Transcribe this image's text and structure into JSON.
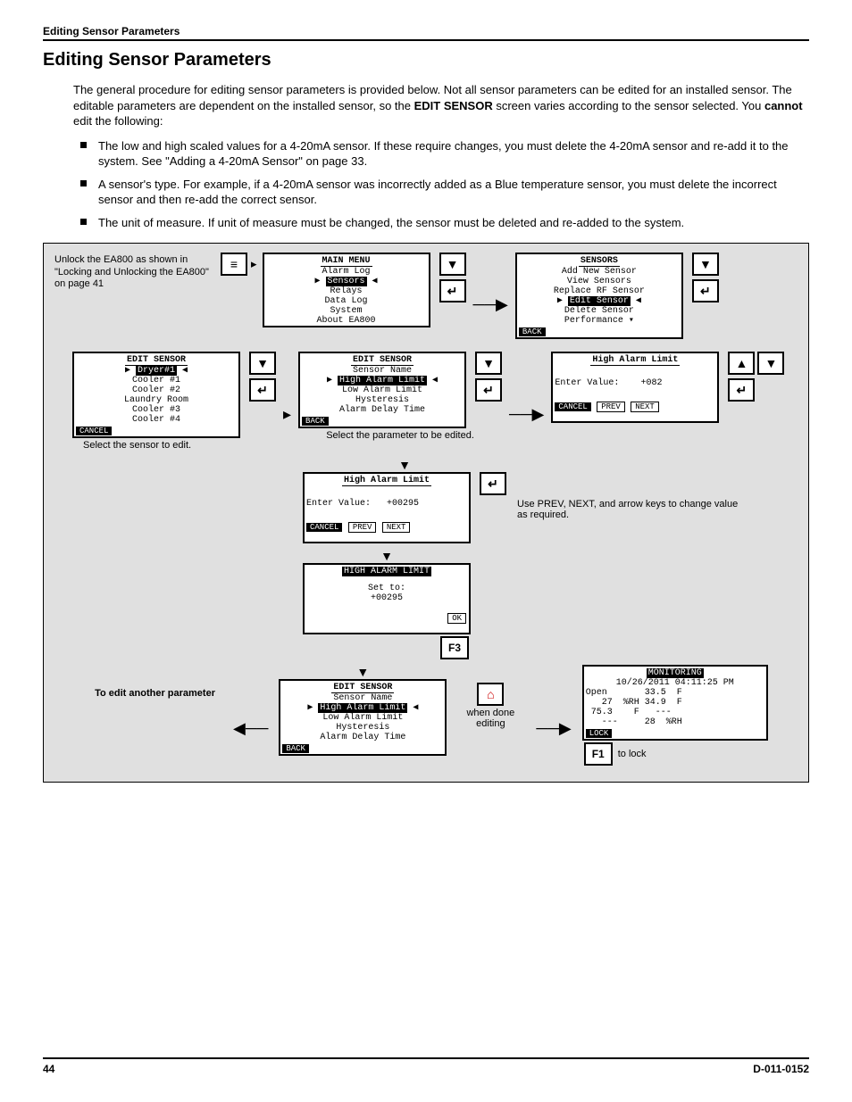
{
  "header": {
    "running_head": "Editing Sensor Parameters"
  },
  "title": "Editing Sensor Parameters",
  "intro": {
    "p1a": "The general procedure for editing sensor parameters is provided below. Not all sensor parameters can be edited for an installed sensor. The editable parameters are dependent on the installed sensor, so the ",
    "p1b_bold": "EDIT SENSOR",
    "p1c": " screen varies according to the sensor selected. You ",
    "p1d_bold": "cannot",
    "p1e": " edit the following:"
  },
  "bullets": [
    "The low and high scaled values for a 4-20mA sensor. If these require changes, you must delete the 4-20mA sensor and re-add it to the system. See \"Adding a 4-20mA Sensor\" on page 33.",
    "A sensor's type. For example, if a 4-20mA sensor was incorrectly added as a Blue temperature sensor, you must delete the incorrect sensor and then re-add the correct sensor.",
    "The unit of measure. If unit of measure must be changed, the sensor must be deleted and re-added to the system."
  ],
  "unlock_caption": "Unlock the EA800 as shown in \"Locking and Unlocking the EA800\" on page 41",
  "main_menu": {
    "title": "MAIN MENU",
    "items": [
      "Alarm Log",
      "Sensors",
      "Relays",
      "Data Log",
      "System",
      "About EA800"
    ],
    "highlight": "Sensors"
  },
  "sensors_menu": {
    "title": "SENSORS",
    "items": [
      "Add New Sensor",
      "View Sensors",
      "Replace RF Sensor",
      "Edit Sensor",
      "Delete Sensor",
      "Performance"
    ],
    "highlight": "Edit Sensor",
    "back": "BACK"
  },
  "edit_sensor_list": {
    "title": "EDIT SENSOR",
    "items": [
      "Dryer#1",
      "Cooler #1",
      "Cooler #2",
      "Laundry Room",
      "Cooler #3",
      "Cooler #4"
    ],
    "highlight": "Dryer#1",
    "cancel": "CANCEL",
    "caption": "Select the sensor to edit."
  },
  "edit_sensor_params": {
    "title": "EDIT SENSOR",
    "items": [
      "Sensor Name",
      "High Alarm Limit",
      "Low Alarm Limit",
      "Hysteresis",
      "Alarm Delay Time"
    ],
    "highlight": "High Alarm Limit",
    "back": "BACK",
    "caption": "Select the parameter to be edited."
  },
  "high_alarm_entry": {
    "title": "High Alarm Limit",
    "enter_label": "Enter Value:",
    "value": "+082",
    "cancel": "CANCEL",
    "prev": "PREV",
    "next": "NEXT"
  },
  "high_alarm_entry2": {
    "title": "High Alarm Limit",
    "enter_label": "Enter Value:",
    "value": "+00295",
    "cancel": "CANCEL",
    "prev": "PREV",
    "next": "NEXT",
    "caption": "Use PREV, NEXT, and arrow keys to change value as required."
  },
  "high_alarm_confirm": {
    "title": "HIGH ALARM LIMIT",
    "set_to": "Set to:",
    "value": "+00295",
    "ok": "OK",
    "softkey": "F3"
  },
  "edit_sensor_params2": {
    "title": "EDIT SENSOR",
    "items": [
      "Sensor Name",
      "High Alarm Limit",
      "Low Alarm Limit",
      "Hysteresis",
      "Alarm Delay Time"
    ],
    "highlight": "High Alarm Limit",
    "back": "BACK",
    "left_caption": "To edit another parameter",
    "right_caption": "when done editing"
  },
  "monitoring": {
    "title": "MONITORING",
    "timestamp": "10/26/2011 04:11:25 PM",
    "l1": "Open       33.5  F",
    "l2": "   27  %RH 34.9  F",
    "l3": " 75.3    F   ---",
    "l4": "   ---     28  %RH",
    "lock": "LOCK",
    "softkey": "F1",
    "caption": "to lock"
  },
  "icons": {
    "down": "▼",
    "enter": "↵",
    "up": "▲",
    "home": "⌂",
    "menu": "≡"
  },
  "footer": {
    "page": "44",
    "doc": "D-011-0152"
  }
}
